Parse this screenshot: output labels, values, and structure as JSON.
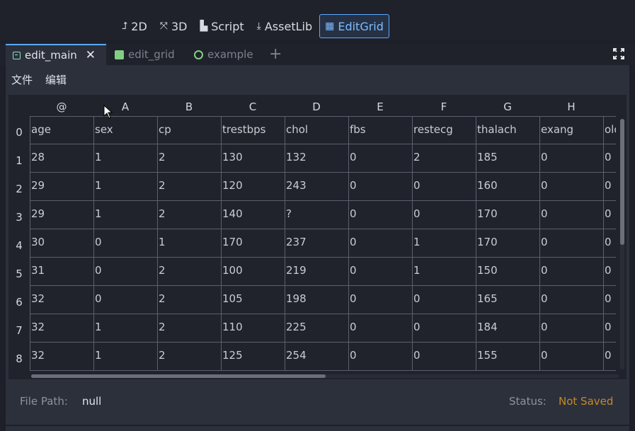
{
  "toolbar": {
    "buttons": [
      {
        "label": "2D",
        "icon": "2d-icon",
        "glyph": "⮥"
      },
      {
        "label": "3D",
        "icon": "3d-icon",
        "glyph": "⤧"
      },
      {
        "label": "Script",
        "icon": "script-icon",
        "glyph": "▙"
      },
      {
        "label": "AssetLib",
        "icon": "download-icon",
        "glyph": "⤓"
      },
      {
        "label": "EditGrid",
        "icon": "grid-icon",
        "glyph": "▦"
      }
    ],
    "active": "EditGrid"
  },
  "tabs": [
    {
      "label": "edit_main",
      "close": "✕",
      "icon": "script-icon"
    },
    {
      "label": "edit_grid",
      "icon": "grid-icon"
    },
    {
      "label": "example",
      "icon": "node-icon"
    }
  ],
  "add_tab": "+",
  "menu": [
    "文件",
    "编辑"
  ],
  "grid": {
    "col_headers": [
      "@",
      "A",
      "B",
      "C",
      "D",
      "E",
      "F",
      "G",
      "H"
    ],
    "row_headers": [
      "0",
      "1",
      "2",
      "3",
      "4",
      "5",
      "6",
      "7",
      "8"
    ],
    "rows": [
      [
        "age",
        "sex",
        "cp",
        "trestbps",
        "chol",
        "fbs",
        "restecg",
        "thalach",
        "exang",
        "oldpeak"
      ],
      [
        "28",
        "1",
        "2",
        "130",
        "132",
        "0",
        "2",
        "185",
        "0",
        "0"
      ],
      [
        "29",
        "1",
        "2",
        "120",
        "243",
        "0",
        "0",
        "160",
        "0",
        "0"
      ],
      [
        "29",
        "1",
        "2",
        "140",
        "?",
        "0",
        "0",
        "170",
        "0",
        "0"
      ],
      [
        "30",
        "0",
        "1",
        "170",
        "237",
        "0",
        "1",
        "170",
        "0",
        "0"
      ],
      [
        "31",
        "0",
        "2",
        "100",
        "219",
        "0",
        "1",
        "150",
        "0",
        "0"
      ],
      [
        "32",
        "0",
        "2",
        "105",
        "198",
        "0",
        "0",
        "165",
        "0",
        "0"
      ],
      [
        "32",
        "1",
        "2",
        "110",
        "225",
        "0",
        "0",
        "184",
        "0",
        "0"
      ],
      [
        "32",
        "1",
        "2",
        "125",
        "254",
        "0",
        "0",
        "155",
        "0",
        "0"
      ]
    ]
  },
  "footer": {
    "file_path_label": "File Path:",
    "file_path_value": "null",
    "status_label": "Status:",
    "status_value": "Not Saved"
  },
  "colors": {
    "accent": "#5aa9ff",
    "status_warning": "#c28a2b"
  }
}
